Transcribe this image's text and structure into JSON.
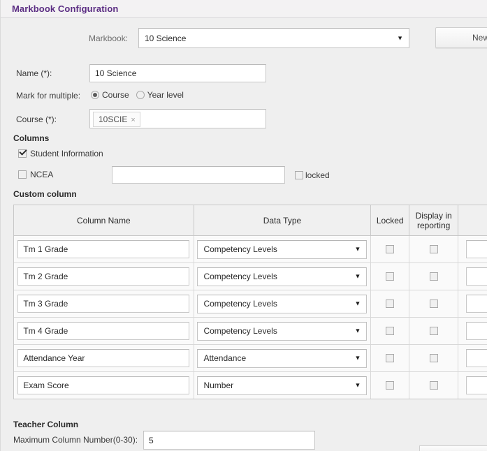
{
  "header": {
    "title": "Markbook Configuration"
  },
  "form": {
    "markbook_label": "Markbook:",
    "markbook_value": "10 Science",
    "new_button": "New",
    "name_label": "Name (*):",
    "name_value": "10 Science",
    "mark_for_multiple_label": "Mark for multiple:",
    "radio_course": "Course",
    "radio_year_level": "Year level",
    "radio_selected": "Course",
    "course_label": "Course (*):",
    "course_chip": "10SCIE",
    "chip_remove": "×"
  },
  "columns": {
    "heading": "Columns",
    "student_information_label": "Student Information",
    "student_information_checked": true,
    "ncea_label": "NCEA",
    "ncea_checked": false,
    "ncea_value": "",
    "locked_label": "locked",
    "locked_checked": false
  },
  "custom_column": {
    "heading": "Custom column",
    "headers": {
      "column_name": "Column Name",
      "data_type": "Data Type",
      "locked": "Locked",
      "display_in_reporting": "Display in\nreporting",
      "extra": ""
    },
    "rows": [
      {
        "name": "Tm 1 Grade",
        "type": "Competency Levels",
        "locked": false,
        "display": false
      },
      {
        "name": "Tm 2 Grade",
        "type": "Competency Levels",
        "locked": false,
        "display": false
      },
      {
        "name": "Tm 3 Grade",
        "type": "Competency Levels",
        "locked": false,
        "display": false
      },
      {
        "name": "Tm 4 Grade",
        "type": "Competency Levels",
        "locked": false,
        "display": false
      },
      {
        "name": "Attendance Year",
        "type": "Attendance",
        "locked": false,
        "display": false
      },
      {
        "name": "Exam Score",
        "type": "Number",
        "locked": false,
        "display": false
      }
    ]
  },
  "teacher_column": {
    "heading": "Teacher Column",
    "max_column_label": "Maximum Column Number(0-30):",
    "max_column_value": "5"
  },
  "icons": {
    "dropdown_arrow": "▼"
  },
  "colors": {
    "title_purple": "#5b2d83",
    "page_bg": "#efefef",
    "required_red": "#b04a4a"
  }
}
